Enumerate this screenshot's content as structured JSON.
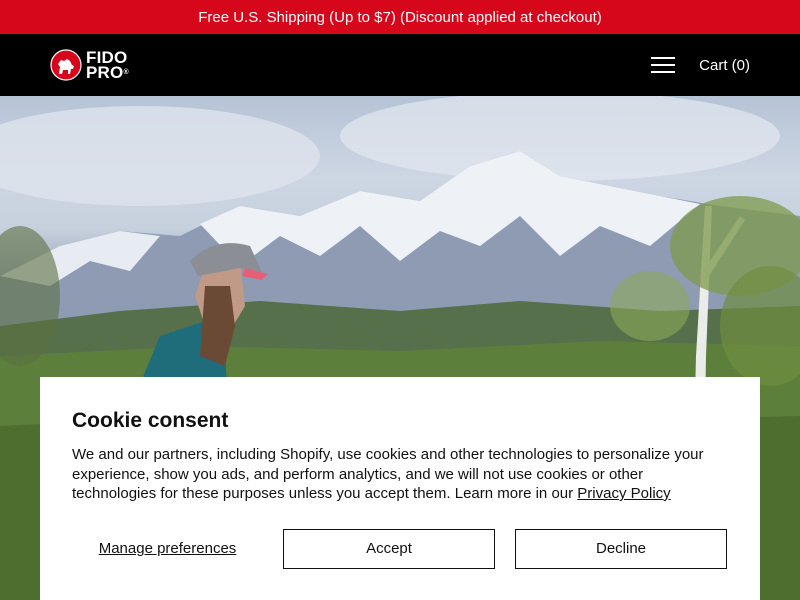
{
  "announcement": {
    "text": "Free U.S. Shipping (Up to $7) (Discount applied at checkout)",
    "bg_color": "#d6061b"
  },
  "header": {
    "logo": {
      "line1": "FIDO",
      "line2": "PRO",
      "mark": "®",
      "accent_color": "#d6061b"
    },
    "menu_icon": "hamburger-menu-icon",
    "cart_label": "Cart (0)"
  },
  "hero": {
    "image_description_icon": "hero-image"
  },
  "cookie": {
    "title": "Cookie consent",
    "body_text": "We and our partners, including Shopify, use cookies and other technologies to personalize your experience, show you ads, and perform analytics, and we will not use cookies or other technologies for these purposes unless you accept them. Learn more in our ",
    "privacy_link": "Privacy Policy",
    "manage_label": "Manage preferences",
    "accept_label": "Accept",
    "decline_label": "Decline"
  }
}
